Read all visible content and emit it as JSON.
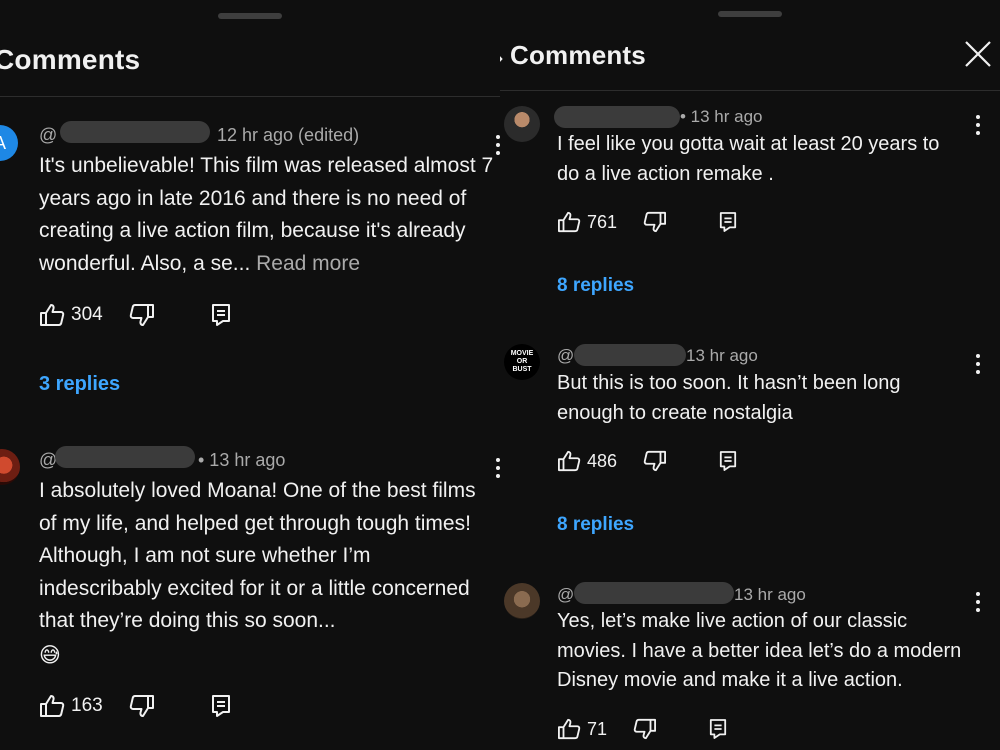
{
  "left": {
    "title": "Comments",
    "comments": [
      {
        "avatar_letter": "A",
        "handle": "@",
        "time": "12 hr ago (edited)",
        "text": "It's unbelievable! This film was released almost 7 years ago in late 2016 and there is no need of creating a live action film, because it's already wonderful. Also, a se...",
        "read_more": "Read more",
        "likes": "304",
        "replies": "3 replies"
      },
      {
        "handle": "@",
        "time": "• 13 hr ago",
        "text": "I absolutely loved Moana! One of the best films of my life, and helped get through tough times! Although, I am not sure whether I’m indescribably excited for it or a little concerned that they’re doing this so soon...",
        "emoji": "😅",
        "likes": "163"
      }
    ]
  },
  "right": {
    "title": "Comments",
    "comments": [
      {
        "time": "• 13 hr ago",
        "text": "I feel like you gotta wait at least 20 years to do a live action remake .",
        "likes": "761",
        "replies": "8 replies"
      },
      {
        "avatar_text": [
          "MOVIE",
          "OR",
          "BUST"
        ],
        "handle": "@",
        "time": "13 hr ago",
        "text": "But this is too soon. It hasn’t been long enough to create nostalgia",
        "likes": "486",
        "replies": "8 replies"
      },
      {
        "handle": "@",
        "time": "13 hr ago",
        "text": "Yes, let’s make live action of our classic movies. I have a better idea let’s do a modern Disney movie and make it a live action.",
        "likes": "71"
      }
    ]
  },
  "colors": {
    "background": "#0f0f0f",
    "text": "#f1f1f1",
    "secondary_text": "#aaaaaa",
    "link_blue": "#3ea6ff",
    "avatar_blue": "#1e88e5"
  }
}
